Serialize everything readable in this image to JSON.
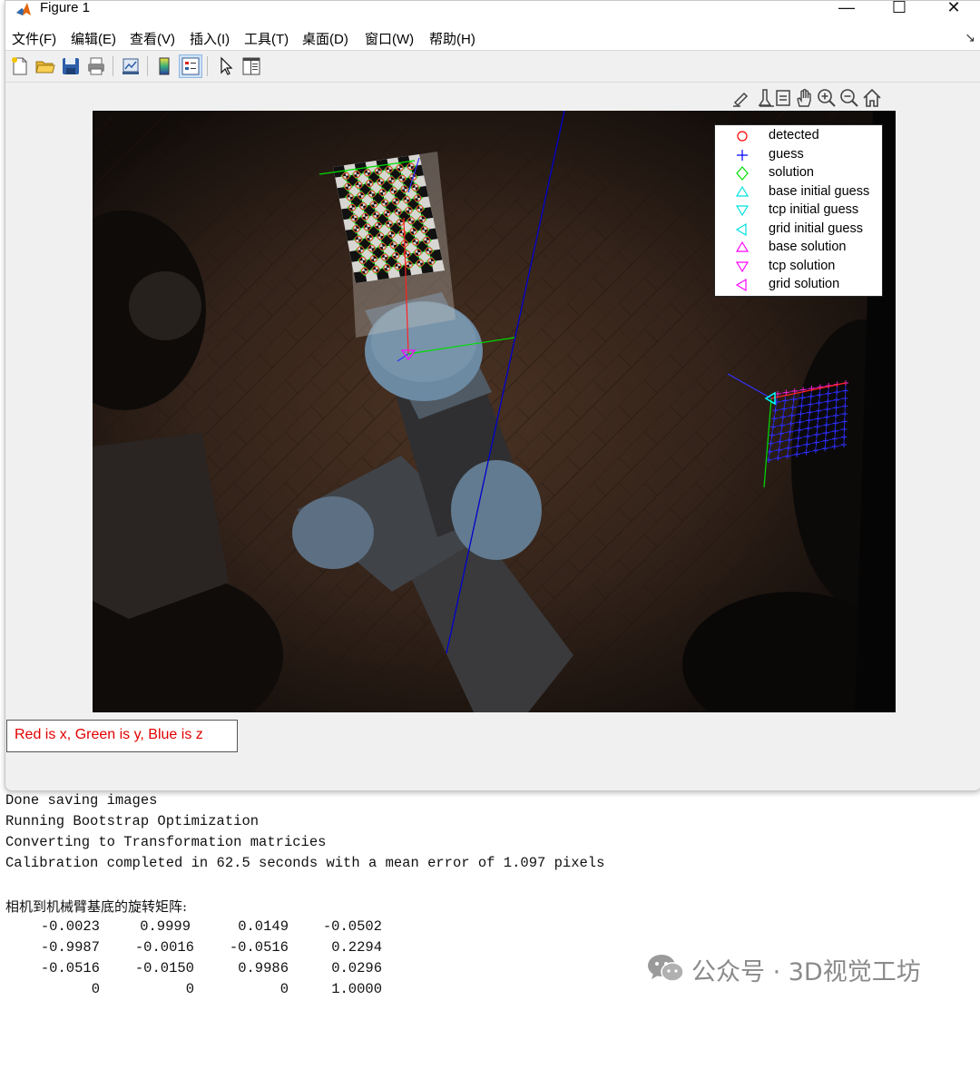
{
  "window": {
    "title": "Figure 1",
    "minimize_glyph": "—",
    "maximize_glyph": "☐",
    "close_glyph": "✕"
  },
  "menu": {
    "items": [
      "文件(F)",
      "编辑(E)",
      "查看(V)",
      "插入(I)",
      "工具(T)",
      "桌面(D)",
      "窗口(W)",
      "帮助(H)"
    ],
    "more_glyph": "↘"
  },
  "toolbar": {
    "buttons": [
      "new-figure-icon",
      "open-file-icon",
      "save-icon",
      "print-icon",
      "link-plot-icon",
      "insert-colorbar-icon",
      "insert-legend-icon",
      "edit-plot-icon",
      "property-inspector-icon"
    ]
  },
  "axes_toolbar": {
    "buttons": [
      "brush-icon",
      "data-tips-icon",
      "pan-hand-icon",
      "zoom-in-icon",
      "zoom-out-icon",
      "home-icon"
    ]
  },
  "legend": {
    "entries": [
      {
        "label": "detected",
        "marker": "circle",
        "color": "#ff0000"
      },
      {
        "label": "guess",
        "marker": "plus",
        "color": "#0000ff"
      },
      {
        "label": "solution",
        "marker": "diamond",
        "color": "#00ff00"
      },
      {
        "label": "base initial guess",
        "marker": "triangle-up",
        "color": "#00ffff"
      },
      {
        "label": "tcp initial guess",
        "marker": "triangle-down",
        "color": "#00ffff"
      },
      {
        "label": "grid initial guess",
        "marker": "triangle-left",
        "color": "#00ffff"
      },
      {
        "label": "base solution",
        "marker": "triangle-up",
        "color": "#ff00ff"
      },
      {
        "label": "tcp solution",
        "marker": "triangle-down",
        "color": "#ff00ff"
      },
      {
        "label": "grid solution",
        "marker": "triangle-left",
        "color": "#ff00ff"
      }
    ]
  },
  "annotation": {
    "text": "Red is x, Green is y, Blue is z",
    "color": "#e00000"
  },
  "console": {
    "lines": [
      "Done saving images",
      "Running Bootstrap Optimization",
      "Converting to Transformation matricies",
      "Calibration completed in 62.5 seconds with a mean error of 1.097 pixels"
    ],
    "matrix_label": "相机到机械臂基底的旋转矩阵:",
    "matrix": [
      [
        "-0.0023",
        "0.9999",
        "0.0149",
        "-0.0502"
      ],
      [
        "-0.9987",
        "-0.0016",
        "-0.0516",
        "0.2294"
      ],
      [
        "-0.0516",
        "-0.0150",
        "0.9986",
        "0.0296"
      ],
      [
        "0",
        "0",
        "0",
        "1.0000"
      ]
    ]
  },
  "watermark": {
    "text": "公众号 · 3D视觉工坊"
  }
}
